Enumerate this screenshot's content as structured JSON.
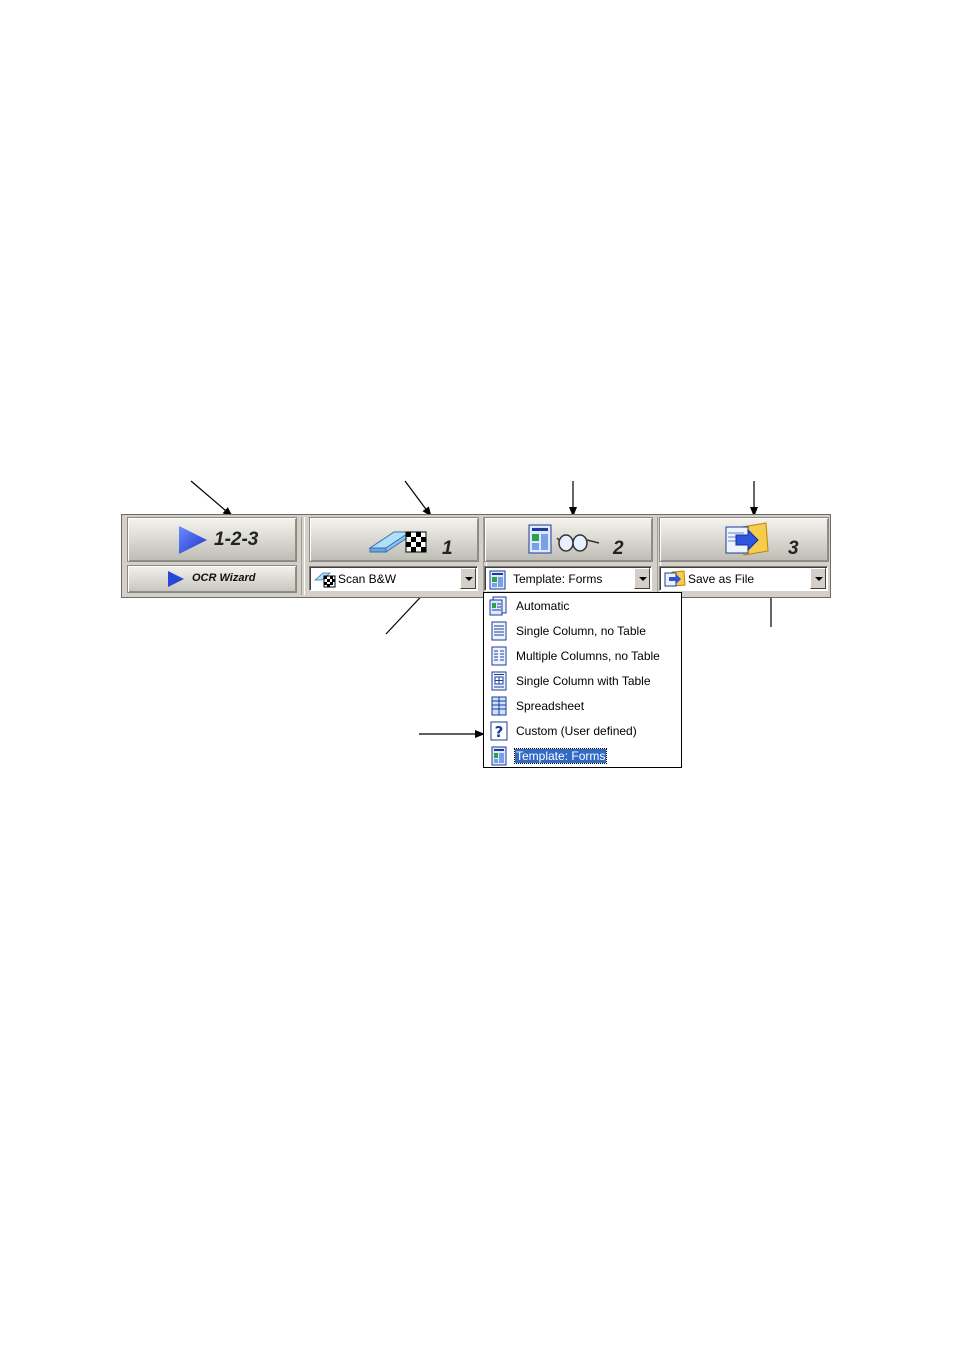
{
  "toolbar": {
    "wizard_button": {
      "label": "1-2-3",
      "icon": "play-triangle-icon"
    },
    "wizard_small_button": {
      "label": "OCR Wizard",
      "icon": "play-triangle-icon"
    },
    "scan_button": {
      "number": "1",
      "icon": "scanner-checkerboard-icon"
    },
    "process_button": {
      "number": "2",
      "icon": "document-glasses-icon"
    },
    "export_button": {
      "number": "3",
      "icon": "folder-arrow-icon"
    },
    "scan_combo": {
      "value": "Scan B&W",
      "icon": "scanner-checkerboard-icon"
    },
    "layout_combo": {
      "value": "Template: Forms",
      "icon": "template-forms-icon"
    },
    "export_combo": {
      "value": "Save as File",
      "icon": "folder-arrow-icon"
    }
  },
  "layout_menu": {
    "items": [
      {
        "label": "Automatic",
        "icon": "automatic-layout-icon",
        "selected": false
      },
      {
        "label": "Single Column, no Table",
        "icon": "single-column-icon",
        "selected": false
      },
      {
        "label": "Multiple Columns, no Table",
        "icon": "multiple-columns-icon",
        "selected": false
      },
      {
        "label": "Single Column with Table",
        "icon": "single-column-table-icon",
        "selected": false
      },
      {
        "label": "Spreadsheet",
        "icon": "spreadsheet-icon",
        "selected": false
      },
      {
        "label": "Custom (User defined)",
        "icon": "question-mark-icon",
        "selected": false
      },
      {
        "label": "Template: Forms",
        "icon": "template-forms-icon",
        "selected": true
      }
    ]
  },
  "colors": {
    "toolbar_bg": "#d4d0c8",
    "selection": "#316ac5",
    "icon_blue": "#2747d8"
  }
}
